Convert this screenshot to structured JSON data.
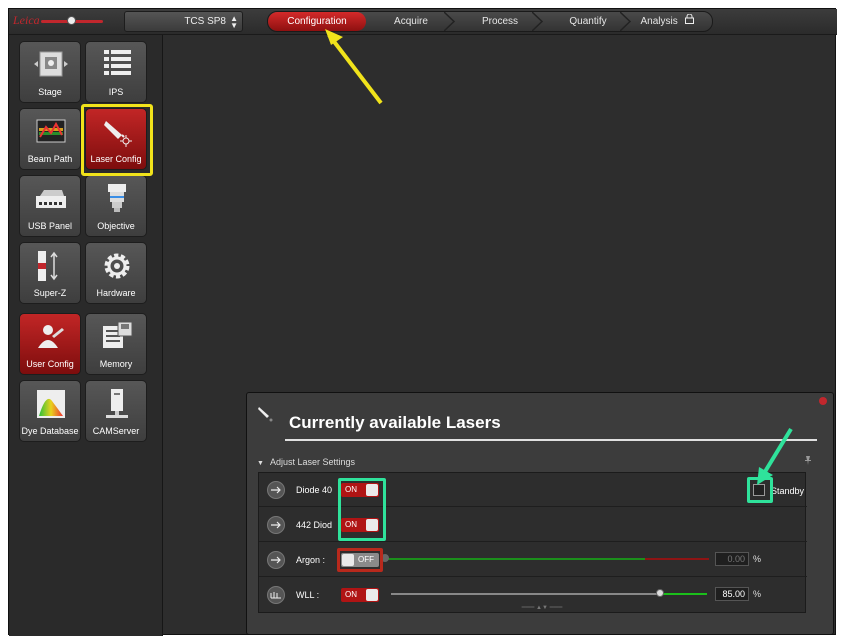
{
  "app": {
    "brand": "Leica"
  },
  "topbar": {
    "system": "TCS SP8",
    "workflow": [
      "Configuration",
      "Acquire",
      "Process",
      "Quantify",
      "Analysis"
    ],
    "active_step": 0
  },
  "sidebar": {
    "items": [
      {
        "label": "Stage",
        "icon": "stage-icon"
      },
      {
        "label": "IPS",
        "icon": "ips-icon"
      },
      {
        "label": "Beam Path",
        "icon": "beam-path-icon"
      },
      {
        "label": "Laser Config",
        "icon": "laser-config-icon"
      },
      {
        "label": "USB Panel",
        "icon": "usb-panel-icon"
      },
      {
        "label": "Objective",
        "icon": "objective-icon"
      },
      {
        "label": "Super-Z",
        "icon": "super-z-icon"
      },
      {
        "label": "Hardware",
        "icon": "gear-icon"
      },
      {
        "label": "User Config",
        "icon": "user-config-icon"
      },
      {
        "label": "Memory",
        "icon": "memory-icon"
      },
      {
        "label": "Dye Database",
        "icon": "dye-database-icon"
      },
      {
        "label": "CAMServer",
        "icon": "camserver-icon"
      }
    ]
  },
  "panel": {
    "title": "Currently available Lasers",
    "section": "Adjust Laser Settings",
    "standby_label": "Standby",
    "lasers": [
      {
        "name": "Diode 40",
        "state": "ON"
      },
      {
        "name": "442 Diod",
        "state": "ON"
      },
      {
        "name": "Argon :",
        "state": "OFF",
        "value": "0.00",
        "unit": "%"
      },
      {
        "name": "WLL :",
        "state": "ON",
        "value": "85.00",
        "unit": "%",
        "level": 0.85
      }
    ]
  },
  "colors": {
    "accent_red": "#c1272d",
    "highlight_yellow": "#f1e31b",
    "highlight_green": "#2fe29b",
    "slider_green": "#1bbf1b"
  }
}
